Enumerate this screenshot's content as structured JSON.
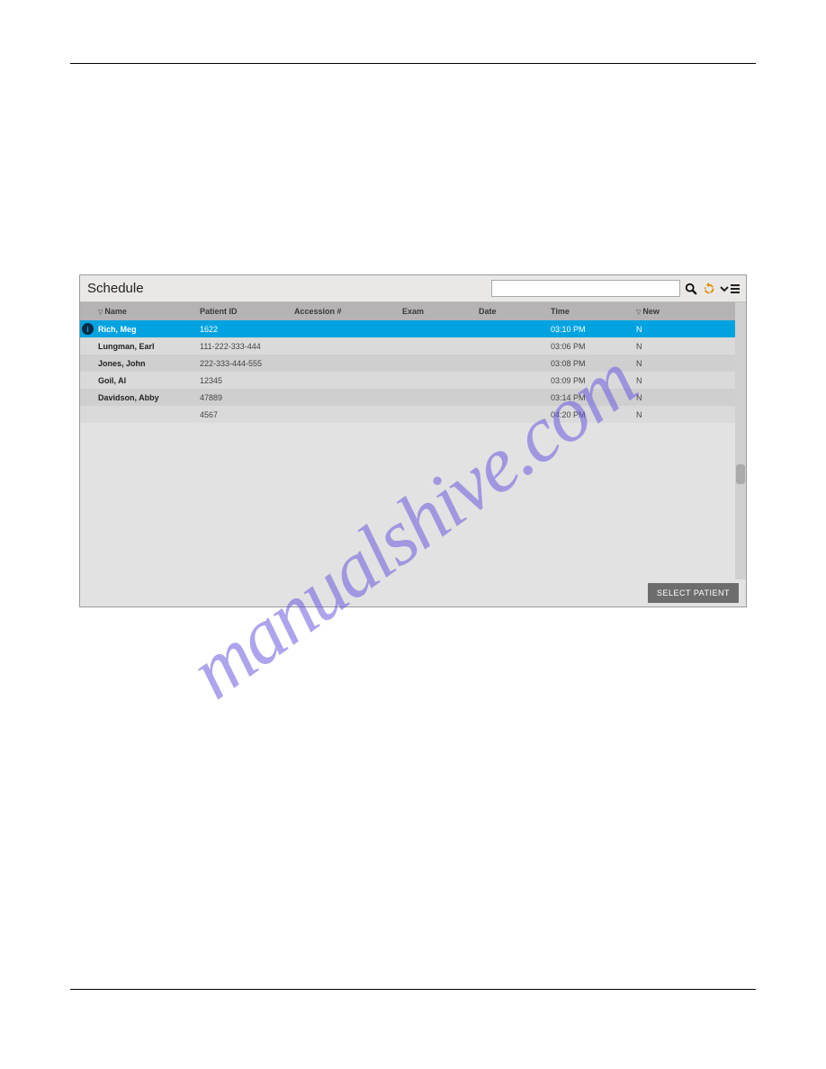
{
  "window": {
    "title": "Schedule",
    "search_placeholder": "",
    "select_button_label": "SELECT PATIENT"
  },
  "columns": {
    "name": "Name",
    "patient_id": "Patient ID",
    "accession": "Accession #",
    "exam": "Exam",
    "date": "Date",
    "time": "Time",
    "new": "New"
  },
  "rows": [
    {
      "name": "Rich, Meg",
      "patient_id": "1622",
      "accession": "",
      "exam": "",
      "date": "",
      "time": "03:10 PM",
      "new": "N",
      "selected": true
    },
    {
      "name": "Lungman, Earl",
      "patient_id": "111-222-333-444",
      "accession": "",
      "exam": "",
      "date": "",
      "time": "03:06 PM",
      "new": "N",
      "selected": false
    },
    {
      "name": "Jones, John",
      "patient_id": "222-333-444-555",
      "accession": "",
      "exam": "",
      "date": "",
      "time": "03:08 PM",
      "new": "N",
      "selected": false
    },
    {
      "name": "Goil, Al",
      "patient_id": "12345",
      "accession": "",
      "exam": "",
      "date": "",
      "time": "03:09 PM",
      "new": "N",
      "selected": false
    },
    {
      "name": "Davidson, Abby",
      "patient_id": "47889",
      "accession": "",
      "exam": "",
      "date": "",
      "time": "03:14 PM",
      "new": "N",
      "selected": false
    },
    {
      "name": "",
      "patient_id": "4567",
      "accession": "",
      "exam": "",
      "date": "",
      "time": "04:20 PM",
      "new": "N",
      "selected": false
    }
  ],
  "watermark": "manualshive.com"
}
